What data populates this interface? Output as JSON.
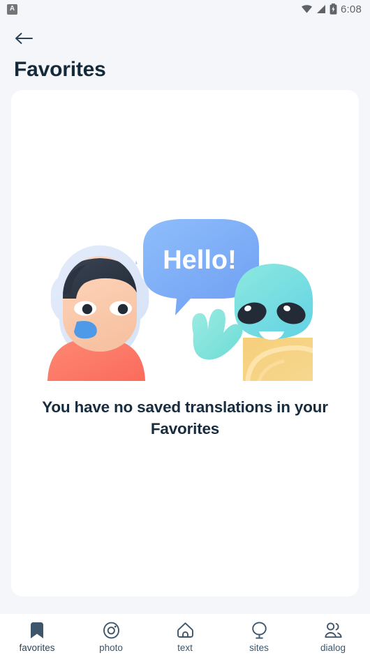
{
  "status_bar": {
    "notification_icon": "android-app-icon",
    "notification_letter": "A",
    "wifi_icon": "wifi-icon",
    "signal_icon": "cellular-signal-icon",
    "battery_icon": "battery-charging-icon",
    "time": "6:08"
  },
  "appbar": {
    "back_icon": "arrow-left-icon",
    "title": "Favorites"
  },
  "empty_state": {
    "illustration_name": "astronaut-and-alien-illustration",
    "speech_bubble_text": "Hello!",
    "message": "You have no saved translations in your Favorites"
  },
  "bottom_nav": {
    "items": [
      {
        "label": "favorites",
        "icon": "bookmark-icon",
        "active": true
      },
      {
        "label": "photo",
        "icon": "camera-icon",
        "active": false
      },
      {
        "label": "text",
        "icon": "home-icon",
        "active": false
      },
      {
        "label": "sites",
        "icon": "globe-icon",
        "active": false
      },
      {
        "label": "dialog",
        "icon": "users-icon",
        "active": false
      }
    ]
  },
  "colors": {
    "background": "#f4f6fa",
    "card": "#ffffff",
    "title": "#142a3b",
    "nav_icon": "#3d566b",
    "bubble_blue": "#74a8f5",
    "alien_teal": "#79e0d8",
    "suit_coral": "#fb7a65",
    "alien_body_yellow": "#f7d27a"
  }
}
